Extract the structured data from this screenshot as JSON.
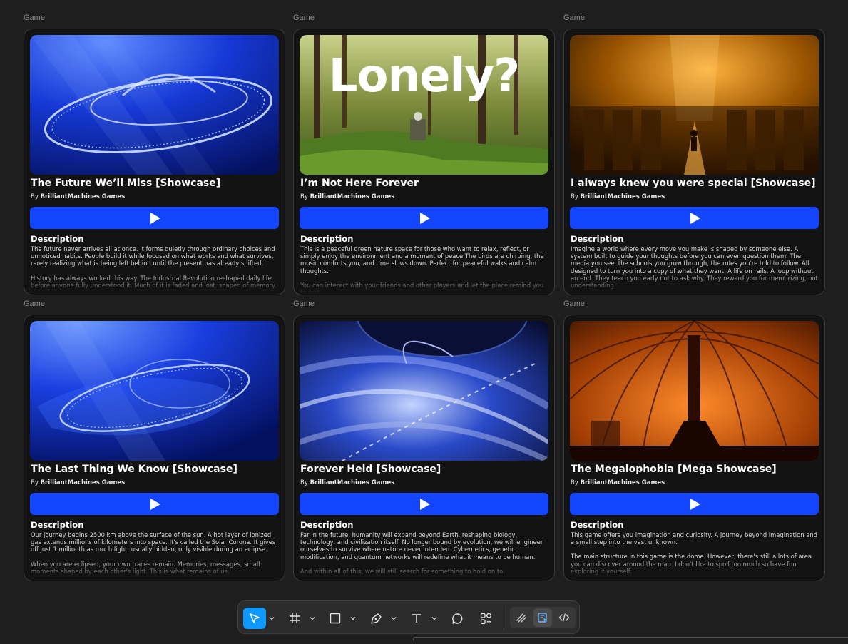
{
  "cards": [
    {
      "frame_label": "Game",
      "title": "The Future We’ll Miss [Showcase]",
      "author_prefix": "By",
      "author": "BrilliantMachines Games",
      "description_heading": "Description",
      "description": [
        "The future never arrives all at once. It forms quietly through ordinary choices and unnoticed habits. People build it while focused on what works and what survives, rarely realizing what is being left behind until the present has already shifted.",
        "History has always worked this way. The Industrial Revolution reshaped daily life before anyone fully understood it. Much of it is faded and lost, shaped of memory."
      ]
    },
    {
      "frame_label": "Game",
      "title": "I’m Not Here Forever",
      "author_prefix": "By",
      "author": "BrilliantMachines Games",
      "thumb_text": "Lonely?",
      "description_heading": "Description",
      "description": [
        "This is a peaceful green nature space for those who want to relax, reflect, or simply enjoy the environment and a moment of peace The birds are chirping, the music comforts you, and time slows down. Perfect for peaceful walks and calm thoughts.",
        "You can interact with your friends and other players and let the place remind you to rest."
      ]
    },
    {
      "frame_label": "Game",
      "title": "I always knew you were special [Showcase]",
      "author_prefix": "By",
      "author": "BrilliantMachines Games",
      "description_heading": "Description",
      "description": [
        "Imagine a world where every move you make is shaped by someone else. A system built to guide your thoughts before you can even question them. The media you see, the schools you grow through, the rules you're told to follow. All designed to turn you into a copy of what they want. A life on rails. A loop without an end. They teach you early not to ask why. They reward you for memorizing, not understanding."
      ]
    },
    {
      "frame_label": "Game",
      "title": "The Last Thing We Know [Showcase]",
      "author_prefix": "By",
      "author": "BrilliantMachines Games",
      "description_heading": "Description",
      "description": [
        "Our journey begins 2500 km above the surface of the sun. A hot layer of ionized gas extends millions of kilometers into space. It's called the Solar Corona. It gives off just 1 millionth as much light, usually hidden, only visible during an eclipse.",
        "When you are eclipsed, your own traces remain. Memories, messages, small moments shaped by each other's light. This is what remains of us."
      ]
    },
    {
      "frame_label": "Game",
      "title": "Forever Held [Showcase]",
      "author_prefix": "By",
      "author": "BrilliantMachines Games",
      "description_heading": "Description",
      "description": [
        "Far in the future, humanity will expand beyond Earth, reshaping biology, technology, and civilization itself. No longer bound by evolution, we will engineer ourselves to survive where nature never intended. Cybernetics, genetic modification, and quantum networks will redefine what it means to be human.",
        "And within all of this, we will still search for something to hold on to."
      ]
    },
    {
      "frame_label": "Game",
      "title": "The Megalophobia [Mega Showcase]",
      "author_prefix": "By",
      "author": "BrilliantMachines Games",
      "description_heading": "Description",
      "description": [
        "This game offers you imagination and curiosity. A journey beyond imagination and a small step into the vast unknown.",
        "The main structure in this game is the dome. However, there's still a lots of area you can discover around the map. I don't like to spoil too much so have fun exploring it yourself."
      ]
    }
  ],
  "toolbar": {
    "tools": [
      "move-tool",
      "frame-tool",
      "shape-tool",
      "pen-tool",
      "text-tool",
      "comment-tool",
      "actions-tool"
    ],
    "right_tools": [
      "draw-mode",
      "design-mode",
      "dev-mode"
    ],
    "accent": "#0d99ff"
  },
  "colors": {
    "play_button": "#1446ff",
    "card_bg": "#131313",
    "canvas_bg": "#1e1e1e"
  }
}
